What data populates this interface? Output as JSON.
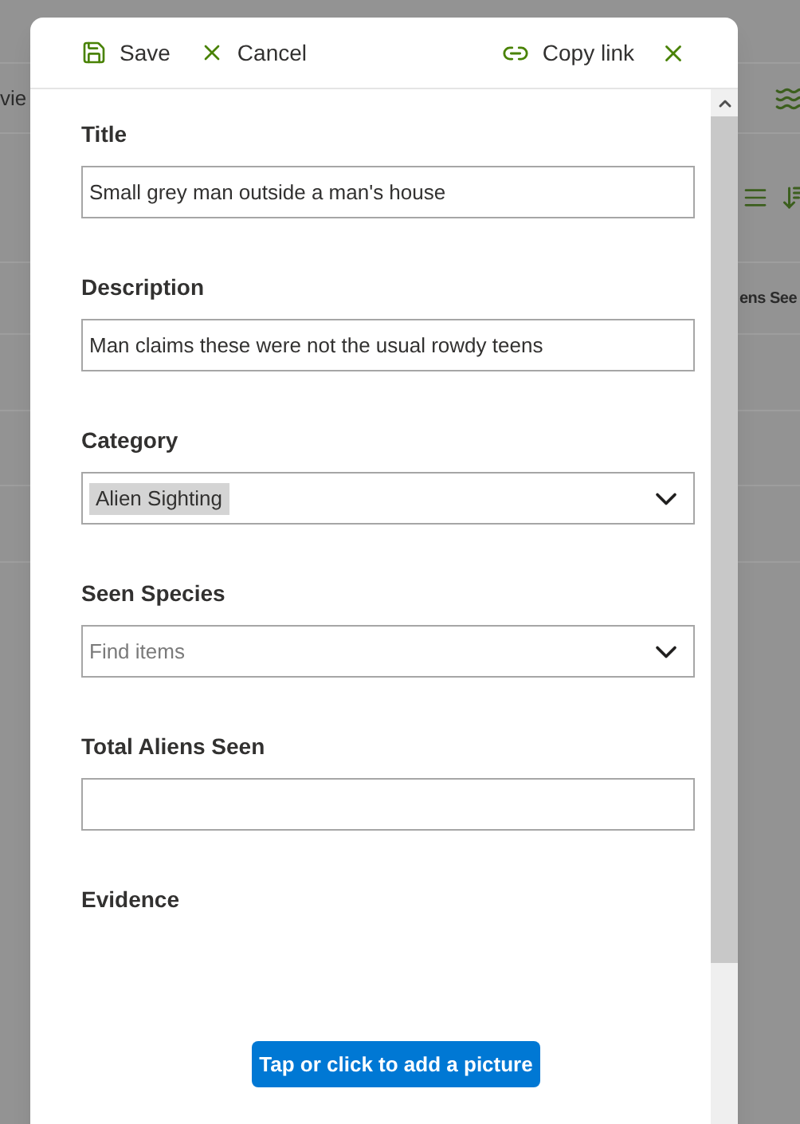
{
  "background": {
    "left_text": "vie",
    "column_header": "ens See"
  },
  "toolbar": {
    "save": "Save",
    "cancel": "Cancel",
    "copy_link": "Copy link"
  },
  "fields": [
    {
      "kind": "text",
      "label": "Title",
      "value": "Small grey man outside a man's house"
    },
    {
      "kind": "text",
      "label": "Description",
      "value": "Man claims these were not the usual rowdy teens"
    },
    {
      "kind": "dropdown",
      "label": "Category",
      "value": "Alien Sighting"
    },
    {
      "kind": "dropdown",
      "label": "Seen Species",
      "placeholder": "Find items"
    },
    {
      "kind": "text",
      "label": "Total Aliens Seen"
    },
    {
      "kind": "image",
      "label": "Evidence",
      "button": "Tap or click to add a picture"
    }
  ]
}
